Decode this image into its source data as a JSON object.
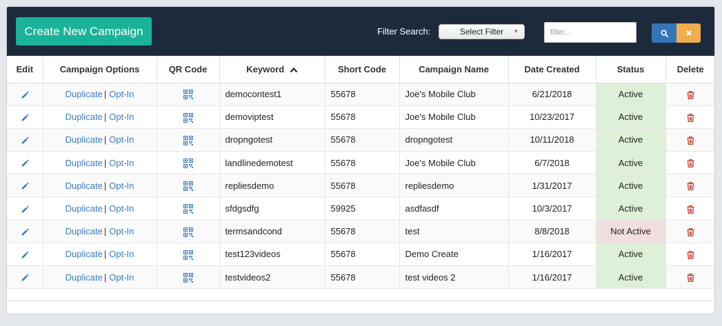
{
  "toolbar": {
    "create_label": "Create New Campaign",
    "filter_label": "Filter Search:",
    "filter_select_value": "Select Filter",
    "filter_input_placeholder": "filter..."
  },
  "table": {
    "headers": {
      "edit": "Edit",
      "options": "Campaign Options",
      "qr": "QR Code",
      "keyword": "Keyword",
      "short_code": "Short Code",
      "campaign_name": "Campaign Name",
      "date_created": "Date Created",
      "status": "Status",
      "delete": "Delete"
    },
    "links": {
      "duplicate": "Duplicate",
      "sep": "|",
      "optin": "Opt-In"
    },
    "rows": [
      {
        "keyword": "democontest1",
        "short_code": "55678",
        "campaign_name": "Joe's Mobile Club",
        "date_created": "6/21/2018",
        "status": "Active"
      },
      {
        "keyword": "demoviptest",
        "short_code": "55678",
        "campaign_name": "Joe's Mobile Club",
        "date_created": "10/23/2017",
        "status": "Active"
      },
      {
        "keyword": "dropngotest",
        "short_code": "55678",
        "campaign_name": "dropngotest",
        "date_created": "10/11/2018",
        "status": "Active"
      },
      {
        "keyword": "landlinedemotest",
        "short_code": "55678",
        "campaign_name": "Joe's Mobile Club",
        "date_created": "6/7/2018",
        "status": "Active"
      },
      {
        "keyword": "repliesdemo",
        "short_code": "55678",
        "campaign_name": "repliesdemo",
        "date_created": "1/31/2017",
        "status": "Active"
      },
      {
        "keyword": "sfdgsdfg",
        "short_code": "59925",
        "campaign_name": "asdfasdf",
        "date_created": "10/3/2017",
        "status": "Active"
      },
      {
        "keyword": "termsandcond",
        "short_code": "55678",
        "campaign_name": "test",
        "date_created": "8/8/2018",
        "status": "Not Active"
      },
      {
        "keyword": "test123videos",
        "short_code": "55678",
        "campaign_name": "Demo Create",
        "date_created": "1/16/2017",
        "status": "Active"
      },
      {
        "keyword": "testvideos2",
        "short_code": "55678",
        "campaign_name": "test videos 2",
        "date_created": "1/16/2017",
        "status": "Active"
      }
    ]
  },
  "colors": {
    "topbar": "#1c2a3c",
    "create_button": "#1bb29a",
    "link": "#3a7bc0",
    "active_bg": "#dff0d8",
    "inactive_bg": "#f2dede",
    "search_button": "#3376b8",
    "clear_button": "#f0ad4e",
    "delete_icon": "#c0392b"
  },
  "icons": {
    "edit": "pencil-icon",
    "qr": "qr-code-icon",
    "delete": "trash-icon",
    "search": "search-icon",
    "clear": "close-icon",
    "sort": "chevron-up-icon",
    "select_caret": "caret-down-icon"
  }
}
